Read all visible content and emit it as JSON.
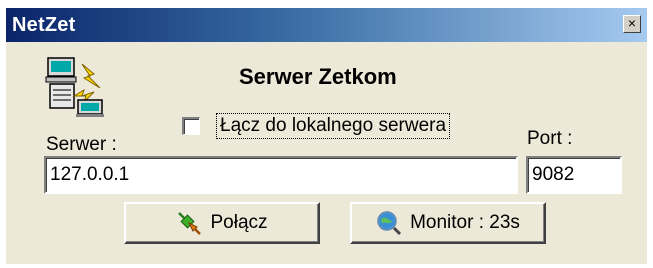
{
  "window": {
    "title": "NetZet",
    "close_glyph": "×",
    "close_icon": "close-icon"
  },
  "app": {
    "icon": "network-computers-icon",
    "heading": "Serwer Zetkom"
  },
  "checkbox": {
    "label": "Łącz do lokalnego serwera",
    "checked": false
  },
  "server": {
    "label": "Serwer :",
    "value": "127.0.0.1"
  },
  "port": {
    "label": "Port :",
    "value": "9082"
  },
  "buttons": {
    "connect": {
      "label": "Połącz",
      "icon": "plug-connect-icon"
    },
    "monitor": {
      "label": "Monitor : 23s",
      "icon": "globe-magnifier-icon"
    }
  },
  "colors": {
    "titlebar_start": "#0a246a",
    "titlebar_end": "#a6caf0",
    "dialog_bg": "#ece9d8"
  }
}
